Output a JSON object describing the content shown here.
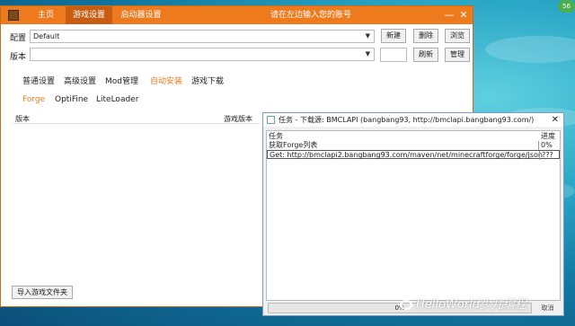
{
  "titlebar": {
    "tabs": [
      {
        "label": "主页"
      },
      {
        "label": "游戏设置",
        "active": true
      },
      {
        "label": "启动器设置"
      }
    ],
    "prompt": "请在左边输入您的账号",
    "minimize": "—",
    "close": "✕"
  },
  "config": {
    "label": "配置",
    "value": "Default",
    "new_btn": "新建",
    "delete_btn": "删除",
    "browse_btn": "浏览"
  },
  "version": {
    "label": "版本",
    "value": "",
    "refresh_btn": "刷新",
    "manage_btn": "管理"
  },
  "nav": [
    "普通设置",
    "高级设置",
    "Mod管理",
    "自动安装",
    "游戏下载"
  ],
  "nav_active_color": "#ee7a1e",
  "subtabs": [
    "Forge",
    "OptiFine",
    "LiteLoader"
  ],
  "list": {
    "col_version": "版本",
    "col_game_version": "游戏版本"
  },
  "import_btn": "导入游戏文件夹",
  "dialog": {
    "title": "任务 - 下载源: BMCLAPI (bangbang93, http://bmclapi.bangbang93.com/)",
    "close": "✕",
    "col_task": "任务",
    "col_progress": "进度",
    "rows": [
      {
        "task": "获取Forge列表",
        "progress": "0%"
      },
      {
        "task": "Get: http://bmclapi2.bangbang93.com/maven/net/minecraftforge/forge/json",
        "progress": "???"
      }
    ],
    "overall_percent": "0%",
    "overall_fraction": 0,
    "stop_label": "取消"
  },
  "badge": "56",
  "watermark": "HelloWorld少儿编程"
}
